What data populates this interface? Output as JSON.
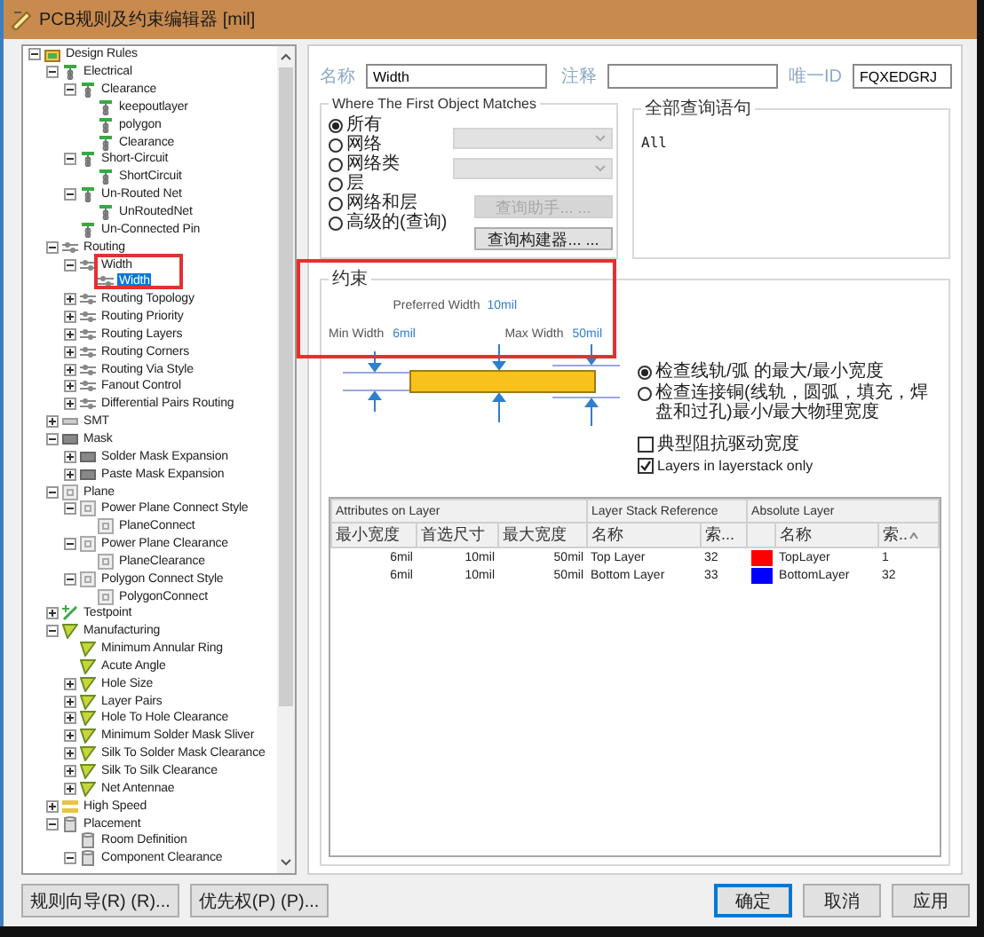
{
  "window": {
    "title": "PCB规则及约束编辑器 [mil]"
  },
  "rule_tree": {
    "items": [
      {
        "label": "Design Rules",
        "kind": "root",
        "selected": false,
        "expanded": true,
        "children": [
          {
            "label": "Electrical",
            "kind": "electrical",
            "selected": false,
            "expanded": true,
            "children": [
              {
                "label": "Clearance",
                "kind": "electrical",
                "selected": false,
                "expanded": true,
                "children": [
                  {
                    "label": "keepoutlayer",
                    "kind": "electrical",
                    "selected": false
                  },
                  {
                    "label": "polygon",
                    "kind": "electrical",
                    "selected": false
                  },
                  {
                    "label": "Clearance",
                    "kind": "electrical",
                    "selected": false
                  }
                ]
              },
              {
                "label": "Short-Circuit",
                "kind": "electrical",
                "selected": false,
                "expanded": true,
                "children": [
                  {
                    "label": "ShortCircuit",
                    "kind": "electrical",
                    "selected": false
                  }
                ]
              },
              {
                "label": "Un-Routed Net",
                "kind": "electrical",
                "selected": false,
                "expanded": true,
                "children": [
                  {
                    "label": "UnRoutedNet",
                    "kind": "electrical",
                    "selected": false
                  }
                ]
              },
              {
                "label": "Un-Connected Pin",
                "kind": "electrical",
                "selected": false
              }
            ]
          },
          {
            "label": "Routing",
            "kind": "routing",
            "selected": false,
            "expanded": true,
            "children": [
              {
                "label": "Width",
                "kind": "routing",
                "selected": false,
                "expanded": true,
                "children": [
                  {
                    "label": "Width",
                    "kind": "routing",
                    "selected": true
                  }
                ]
              },
              {
                "label": "Routing Topology",
                "kind": "routing",
                "selected": false,
                "expanded": false
              },
              {
                "label": "Routing Priority",
                "kind": "routing",
                "selected": false,
                "expanded": false
              },
              {
                "label": "Routing Layers",
                "kind": "routing",
                "selected": false,
                "expanded": false
              },
              {
                "label": "Routing Corners",
                "kind": "routing",
                "selected": false,
                "expanded": false
              },
              {
                "label": "Routing Via Style",
                "kind": "routing",
                "selected": false,
                "expanded": false
              },
              {
                "label": "Fanout Control",
                "kind": "routing",
                "selected": false,
                "expanded": false
              },
              {
                "label": "Differential Pairs Routing",
                "kind": "routing",
                "selected": false,
                "expanded": false
              }
            ]
          },
          {
            "label": "SMT",
            "kind": "smt",
            "selected": false,
            "expanded": false
          },
          {
            "label": "Mask",
            "kind": "mask",
            "selected": false,
            "expanded": true,
            "children": [
              {
                "label": "Solder Mask Expansion",
                "kind": "mask",
                "selected": false,
                "expanded": false
              },
              {
                "label": "Paste Mask Expansion",
                "kind": "mask",
                "selected": false,
                "expanded": false
              }
            ]
          },
          {
            "label": "Plane",
            "kind": "plane",
            "selected": false,
            "expanded": true,
            "children": [
              {
                "label": "Power Plane Connect Style",
                "kind": "plane",
                "selected": false,
                "expanded": true,
                "children": [
                  {
                    "label": "PlaneConnect",
                    "kind": "plane",
                    "selected": false
                  }
                ]
              },
              {
                "label": "Power Plane Clearance",
                "kind": "plane",
                "selected": false,
                "expanded": true,
                "children": [
                  {
                    "label": "PlaneClearance",
                    "kind": "plane",
                    "selected": false
                  }
                ]
              },
              {
                "label": "Polygon Connect Style",
                "kind": "plane",
                "selected": false,
                "expanded": true,
                "children": [
                  {
                    "label": "PolygonConnect",
                    "kind": "plane",
                    "selected": false
                  }
                ]
              }
            ]
          },
          {
            "label": "Testpoint",
            "kind": "testpoint",
            "selected": false,
            "expanded": false
          },
          {
            "label": "Manufacturing",
            "kind": "manufacturing",
            "selected": false,
            "expanded": true,
            "children": [
              {
                "label": "Minimum Annular Ring",
                "kind": "manufacturing",
                "selected": false
              },
              {
                "label": "Acute Angle",
                "kind": "manufacturing",
                "selected": false
              },
              {
                "label": "Hole Size",
                "kind": "manufacturing",
                "selected": false,
                "expanded": false
              },
              {
                "label": "Layer Pairs",
                "kind": "manufacturing",
                "selected": false,
                "expanded": false
              },
              {
                "label": "Hole To Hole Clearance",
                "kind": "manufacturing",
                "selected": false,
                "expanded": false
              },
              {
                "label": "Minimum Solder Mask Sliver",
                "kind": "manufacturing",
                "selected": false,
                "expanded": false
              },
              {
                "label": "Silk To Solder Mask Clearance",
                "kind": "manufacturing",
                "selected": false,
                "expanded": false
              },
              {
                "label": "Silk To Silk Clearance",
                "kind": "manufacturing",
                "selected": false,
                "expanded": false
              },
              {
                "label": "Net Antennae",
                "kind": "manufacturing",
                "selected": false,
                "expanded": false
              }
            ]
          },
          {
            "label": "High Speed",
            "kind": "highspeed",
            "selected": false,
            "expanded": false
          },
          {
            "label": "Placement",
            "kind": "placement",
            "selected": false,
            "expanded": true,
            "children": [
              {
                "label": "Room Definition",
                "kind": "placement",
                "selected": false
              },
              {
                "label": "Component Clearance",
                "kind": "placement",
                "selected": false,
                "expanded": true
              }
            ]
          }
        ]
      }
    ]
  },
  "rule": {
    "name_label": "名称",
    "name": "Width",
    "comment_label": "注释",
    "id_label": "唯一ID",
    "id": "FQXEDGRJ"
  },
  "scope": {
    "title": "Where The First Object Matches",
    "options": [
      {
        "label": "所有",
        "selected": true
      },
      {
        "label": "网络",
        "selected": false
      },
      {
        "label": "网络类",
        "selected": false
      },
      {
        "label": "层",
        "selected": false
      },
      {
        "label": "网络和层",
        "selected": false
      },
      {
        "label": "高级的(查询)",
        "selected": false
      }
    ],
    "dropdowns": [
      {
        "disabled": true
      },
      {
        "disabled": true
      }
    ],
    "buttons": [
      {
        "label": "查询助手... ...",
        "disabled": true
      },
      {
        "label": "查询构建器... ...",
        "disabled": false
      }
    ]
  },
  "query": {
    "title": "全部查询语句",
    "text": "All"
  },
  "constraints": {
    "title": "约束",
    "preferred": {
      "label": "Preferred Width",
      "value": "10mil"
    },
    "min": {
      "label": "Min Width",
      "value": "6mil"
    },
    "max": {
      "label": "Max Width",
      "value": "50mil"
    },
    "check_modes": [
      {
        "label": "检查线轨/弧 的最大/最小宽度",
        "selected": true
      },
      {
        "label": "检查连接铜(线轨，圆弧，填充，焊盘和过孔)最小/最大物理宽度",
        "selected": false
      }
    ],
    "options": [
      {
        "label": "典型阻抗驱动宽度",
        "checked": false
      },
      {
        "label": "Layers in layerstack only",
        "checked": true
      }
    ],
    "table": {
      "groups": [
        "Attributes on Layer",
        "Layer Stack Reference",
        "Absolute Layer"
      ],
      "columns": [
        {
          "label": "最小宽度",
          "sorted": false
        },
        {
          "label": "首选尺寸",
          "sorted": false
        },
        {
          "label": "最大宽度",
          "sorted": false
        },
        {
          "label": "名称",
          "sorted": false
        },
        {
          "label": "索...",
          "sorted": false
        },
        {
          "label": "名称",
          "sorted": false
        },
        {
          "label": "索..",
          "sorted": true
        }
      ],
      "rows": [
        {
          "min": "6mil",
          "preferred": "10mil",
          "max": "50mil",
          "stack_name": "Top Layer",
          "stack_index": "32",
          "color": "#ff0000",
          "layer_name": "TopLayer",
          "layer_index": "1"
        },
        {
          "min": "6mil",
          "preferred": "10mil",
          "max": "50mil",
          "stack_name": "Bottom Layer",
          "stack_index": "33",
          "color": "#0000ff",
          "layer_name": "BottomLayer",
          "layer_index": "32"
        }
      ]
    }
  },
  "footer": {
    "left_buttons": [
      {
        "label": "规则向导(R) (R)...",
        "default": false
      },
      {
        "label": "优先权(P) (P)...",
        "default": false
      }
    ],
    "right_buttons": [
      {
        "label": "确定",
        "default": true
      },
      {
        "label": "取消",
        "default": false
      },
      {
        "label": "应用",
        "default": false
      }
    ]
  }
}
